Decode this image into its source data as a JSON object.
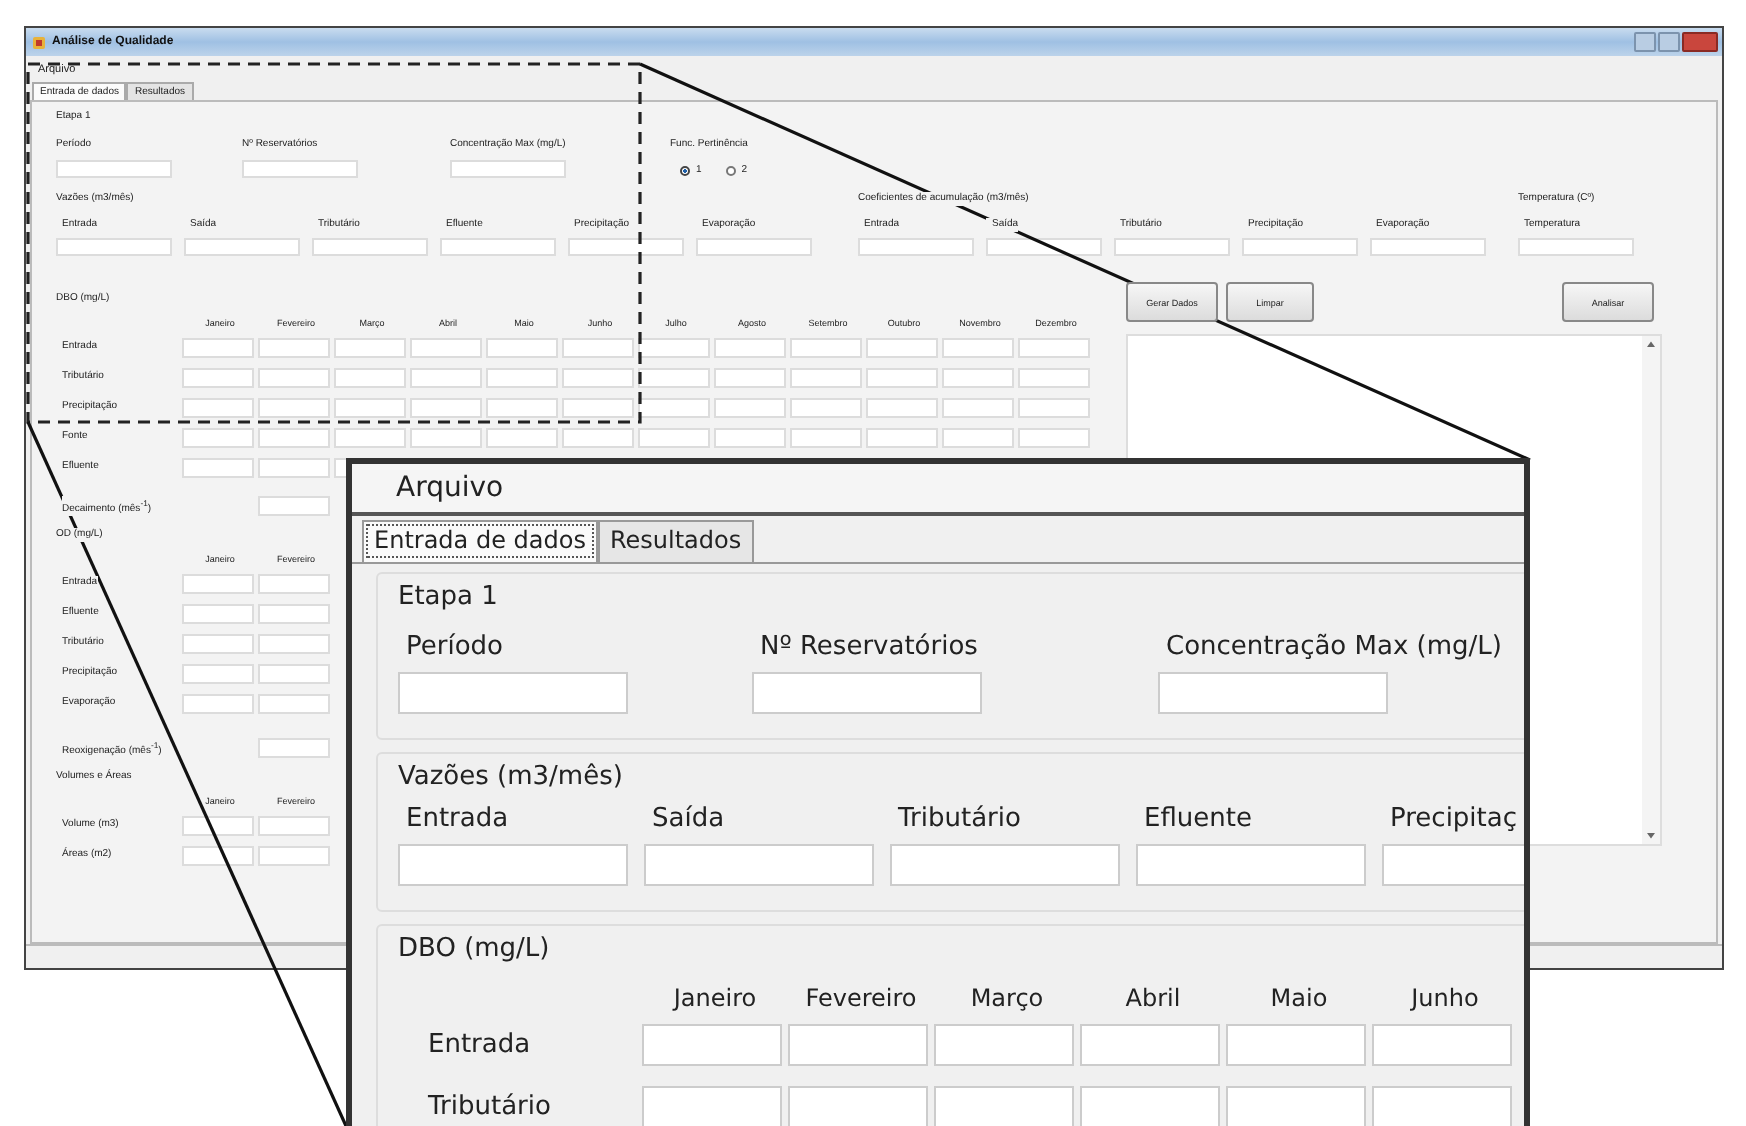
{
  "window": {
    "title": "Análise de Qualidade"
  },
  "menu": [
    "Arquivo"
  ],
  "tabs": [
    {
      "label": "Entrada de dados",
      "selected": true
    },
    {
      "label": "Resultados",
      "selected": false
    }
  ],
  "etapa": {
    "title": "Etapa 1",
    "fields": [
      "Período",
      "Nº Reservatórios",
      "Concentração Max (mg/L)"
    ]
  },
  "pertinencia": {
    "title": "Func. Pertinência",
    "options": [
      {
        "label": "1",
        "selected": true
      },
      {
        "label": "2",
        "selected": false
      }
    ]
  },
  "vazoes": {
    "title": "Vazões (m3/mês)",
    "fields": [
      "Entrada",
      "Saída",
      "Tributário",
      "Efluente",
      "Precipitação",
      "Evaporação"
    ]
  },
  "coeficientes": {
    "title": "Coeficientes de acumulação (m3/mês)",
    "fields": [
      "Entrada",
      "Saída",
      "Tributário",
      "Precipitação",
      "Evaporação"
    ]
  },
  "temperatura": {
    "title": "Temperatura (Cº)",
    "fields": [
      "Temperatura"
    ]
  },
  "dbo": {
    "title": "DBO (mg/L)",
    "months": [
      "Janeiro",
      "Fevereiro",
      "Março",
      "Abril",
      "Maio",
      "Junho",
      "Julho",
      "Agosto",
      "Setembro",
      "Outubro",
      "Novembro",
      "Dezembro"
    ],
    "rows": [
      "Entrada",
      "Tributário",
      "Precipitação",
      "Fonte",
      "Efluente"
    ]
  },
  "decaimento": "Decaimento (mês$^{-1}$)",
  "od": {
    "title": "OD (mg/L)",
    "months": [
      "Janeiro",
      "Fevereiro"
    ],
    "rows": [
      "Entrada",
      "Efluente",
      "Tributário",
      "Precipitação",
      "Evaporação"
    ]
  },
  "reoxigenacao": "Reoxigenação (mês$^{-1}$)",
  "volumes": {
    "title": "Volumes e Áreas",
    "months": [
      "Janeiro",
      "Fevereiro"
    ],
    "rows": [
      "Volume (m3)",
      "Áreas (m2)"
    ]
  },
  "buttons": [
    "Gerar Dados",
    "Limpar",
    "Analisar"
  ],
  "inset": {
    "menu": [
      "Arquivo"
    ],
    "tabs": [
      {
        "label": "Entrada de dados",
        "selected": true
      },
      {
        "label": "Resultados",
        "selected": false
      }
    ],
    "etapa": {
      "title": "Etapa 1",
      "fields": [
        "Período",
        "Nº Reservatórios",
        "Concentração Max (mg/L)"
      ]
    },
    "vazoes": {
      "title": "Vazões (m3/mês)",
      "fields": [
        "Entrada",
        "Saída",
        "Tributário",
        "Efluente",
        "Precipitaç"
      ]
    },
    "dbo": {
      "title": "DBO (mg/L)",
      "months": [
        "Janeiro",
        "Fevereiro",
        "Março",
        "Abril",
        "Maio",
        "Junho"
      ],
      "rows": [
        "Entrada",
        "Tributário"
      ]
    }
  }
}
